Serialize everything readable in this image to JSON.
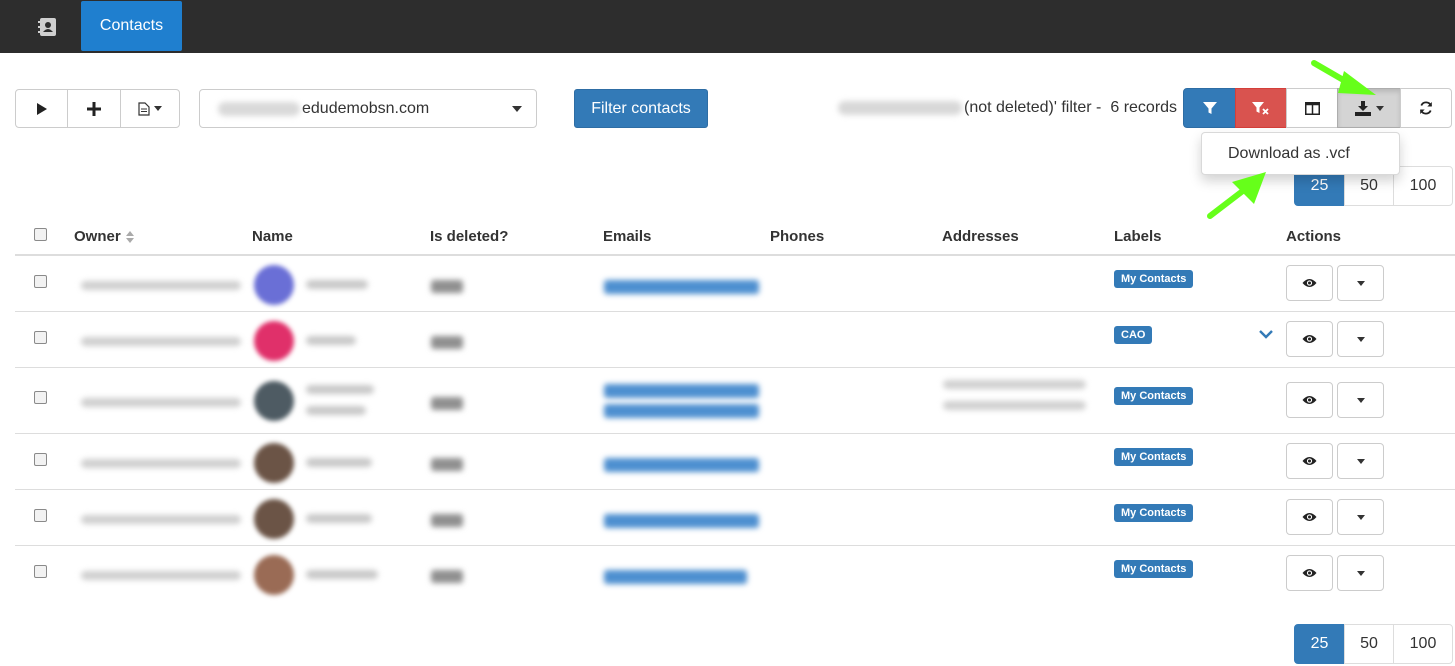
{
  "nav": {
    "tab_label": "Contacts",
    "app_icon": "address-book-icon"
  },
  "toolbar": {
    "run_icon": "play-icon",
    "add_icon": "plus-icon",
    "document_icon": "document-icon",
    "account_value_suffix": "edudemobsn.com",
    "filter_button_label": "Filter contacts",
    "filter_info_text": "(not deleted)' filter -",
    "records_text": "6 records",
    "right_icons": [
      "filter-icon",
      "filter-clear-icon",
      "columns-icon",
      "download-icon",
      "refresh-icon"
    ]
  },
  "dropdown": {
    "items": [
      "Download as .vcf"
    ]
  },
  "pagination": {
    "options": [
      "25",
      "50",
      "100"
    ],
    "selected": "25"
  },
  "table": {
    "headers": {
      "owner": "Owner",
      "name": "Name",
      "is_deleted": "Is deleted?",
      "emails": "Emails",
      "phones": "Phones",
      "addresses": "Addresses",
      "labels": "Labels",
      "actions": "Actions"
    },
    "rows": [
      {
        "label": "My Contacts"
      },
      {
        "label": "CAO"
      },
      {
        "label": "My Contacts"
      },
      {
        "label": "My Contacts"
      },
      {
        "label": "My Contacts"
      },
      {
        "label": "My Contacts"
      }
    ]
  },
  "colors": {
    "topbar": "#2d2d2d",
    "active_tab": "#1f7fcf",
    "primary": "#337ab7",
    "danger": "#d9534f",
    "arrow": "#66ff1a"
  }
}
